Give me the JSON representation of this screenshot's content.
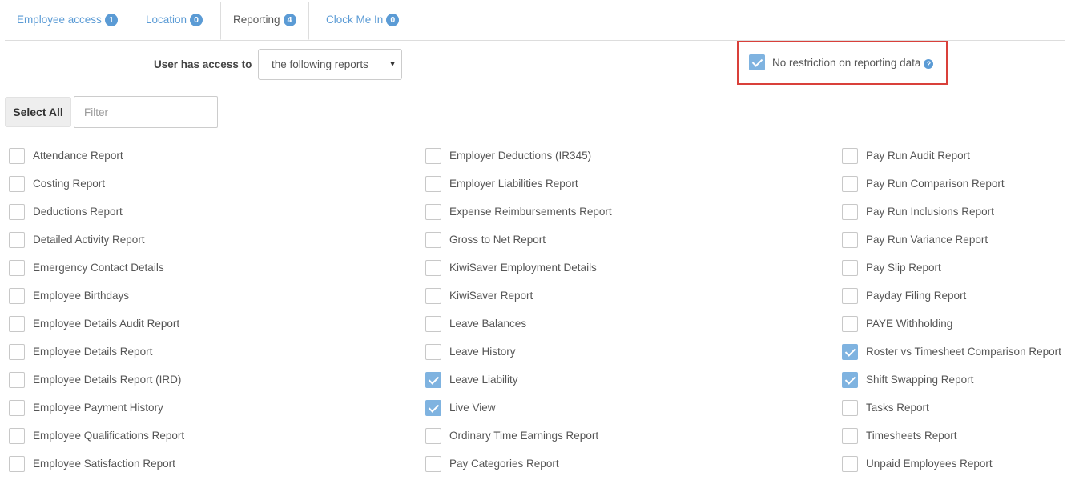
{
  "tabs": [
    {
      "label": "Employee access",
      "count": "1",
      "active": false
    },
    {
      "label": "Location",
      "count": "0",
      "active": false
    },
    {
      "label": "Reporting",
      "count": "4",
      "active": true
    },
    {
      "label": "Clock Me In",
      "count": "0",
      "active": false
    }
  ],
  "access": {
    "label": "User has access to",
    "selected": "the following reports"
  },
  "restriction": {
    "label": "No restriction on reporting data",
    "checked": true,
    "help_icon": "question-circle-icon"
  },
  "toolbar": {
    "select_all_label": "Select All",
    "filter_placeholder": "Filter"
  },
  "reports": {
    "col1": [
      {
        "label": "Attendance Report",
        "checked": false
      },
      {
        "label": "Costing Report",
        "checked": false
      },
      {
        "label": "Deductions Report",
        "checked": false
      },
      {
        "label": "Detailed Activity Report",
        "checked": false
      },
      {
        "label": "Emergency Contact Details",
        "checked": false
      },
      {
        "label": "Employee Birthdays",
        "checked": false
      },
      {
        "label": "Employee Details Audit Report",
        "checked": false
      },
      {
        "label": "Employee Details Report",
        "checked": false
      },
      {
        "label": "Employee Details Report (IRD)",
        "checked": false
      },
      {
        "label": "Employee Payment History",
        "checked": false
      },
      {
        "label": "Employee Qualifications Report",
        "checked": false
      },
      {
        "label": "Employee Satisfaction Report",
        "checked": false
      }
    ],
    "col2": [
      {
        "label": "Employer Deductions (IR345)",
        "checked": false
      },
      {
        "label": "Employer Liabilities Report",
        "checked": false
      },
      {
        "label": "Expense Reimbursements Report",
        "checked": false
      },
      {
        "label": "Gross to Net Report",
        "checked": false
      },
      {
        "label": "KiwiSaver Employment Details",
        "checked": false
      },
      {
        "label": "KiwiSaver Report",
        "checked": false
      },
      {
        "label": "Leave Balances",
        "checked": false
      },
      {
        "label": "Leave History",
        "checked": false
      },
      {
        "label": "Leave Liability",
        "checked": true
      },
      {
        "label": "Live View",
        "checked": true
      },
      {
        "label": "Ordinary Time Earnings Report",
        "checked": false
      },
      {
        "label": "Pay Categories Report",
        "checked": false
      }
    ],
    "col3": [
      {
        "label": "Pay Run Audit Report",
        "checked": false
      },
      {
        "label": "Pay Run Comparison Report",
        "checked": false
      },
      {
        "label": "Pay Run Inclusions Report",
        "checked": false
      },
      {
        "label": "Pay Run Variance Report",
        "checked": false
      },
      {
        "label": "Pay Slip Report",
        "checked": false
      },
      {
        "label": "Payday Filing Report",
        "checked": false
      },
      {
        "label": "PAYE Withholding",
        "checked": false
      },
      {
        "label": "Roster vs Timesheet Comparison Report",
        "checked": true
      },
      {
        "label": "Shift Swapping Report",
        "checked": true
      },
      {
        "label": "Tasks Report",
        "checked": false
      },
      {
        "label": "Timesheets Report",
        "checked": false
      },
      {
        "label": "Unpaid Employees Report",
        "checked": false
      }
    ]
  },
  "colors": {
    "accent": "#5b9bd5",
    "checked": "#7fb3e0",
    "highlight_border": "#d9403a"
  }
}
